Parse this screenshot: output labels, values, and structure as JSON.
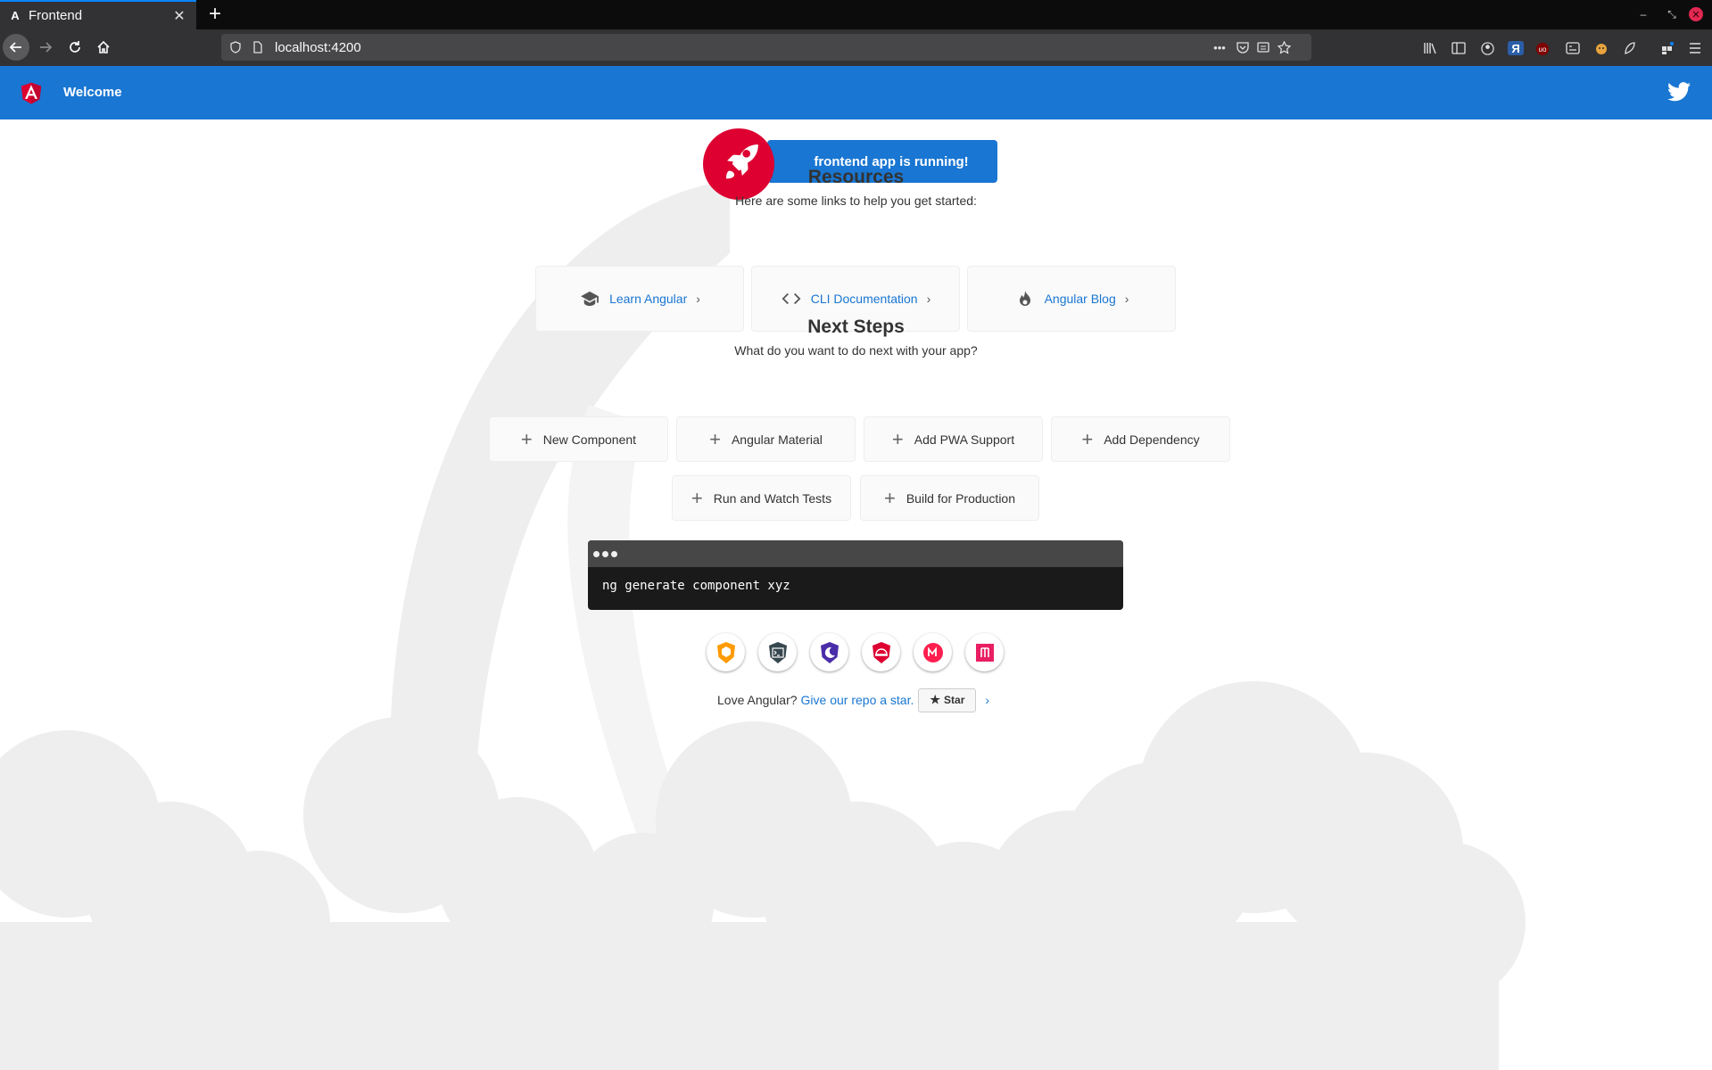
{
  "browser": {
    "tab_title": "Frontend",
    "tab_favicon": "A",
    "url": "localhost:4200",
    "new_tab_symbol": "+",
    "tab_close_symbol": "✕",
    "win_minimize": "–",
    "win_restore": "⤡",
    "win_close": "✕",
    "extension_letter": "Я",
    "pocket_badge": "uo"
  },
  "toolbar": {
    "welcome": "Welcome",
    "background_color": "#1976d2"
  },
  "hero": {
    "running_text": "frontend app is running!",
    "rocket_color": "#dd0031"
  },
  "resources": {
    "title": "Resources",
    "subtitle": "Here are some links to help you get started:",
    "cards": [
      {
        "label": "Learn Angular",
        "icon": "graduation-cap-icon"
      },
      {
        "label": "CLI Documentation",
        "icon": "code-icon"
      },
      {
        "label": "Angular Blog",
        "icon": "flame-icon"
      }
    ],
    "chevron": "›"
  },
  "next_steps": {
    "title": "Next Steps",
    "subtitle": "What do you want to do next with your app?",
    "plus": "+",
    "cards": [
      {
        "label": "New Component"
      },
      {
        "label": "Angular Material"
      },
      {
        "label": "Add PWA Support"
      },
      {
        "label": "Add Dependency"
      },
      {
        "label": "Run and Watch Tests"
      },
      {
        "label": "Build for Production"
      }
    ]
  },
  "terminal": {
    "command": "ng generate component xyz"
  },
  "circle_links": [
    {
      "name": "animations-icon",
      "color": "#ff9a00"
    },
    {
      "name": "cli-icon",
      "color": "#37474f"
    },
    {
      "name": "augury-icon",
      "color": "#4a2da8"
    },
    {
      "name": "protractor-icon",
      "color": "#dd0031"
    },
    {
      "name": "nrwl-icon",
      "color": "#ff1f4e"
    },
    {
      "name": "angular-material-icon",
      "color": "#e91e63"
    }
  ],
  "footer": {
    "love_text": "Love Angular?",
    "repo_link": "Give our repo a star.",
    "star_label": "Star",
    "star_symbol": "★",
    "chevron": "›"
  }
}
